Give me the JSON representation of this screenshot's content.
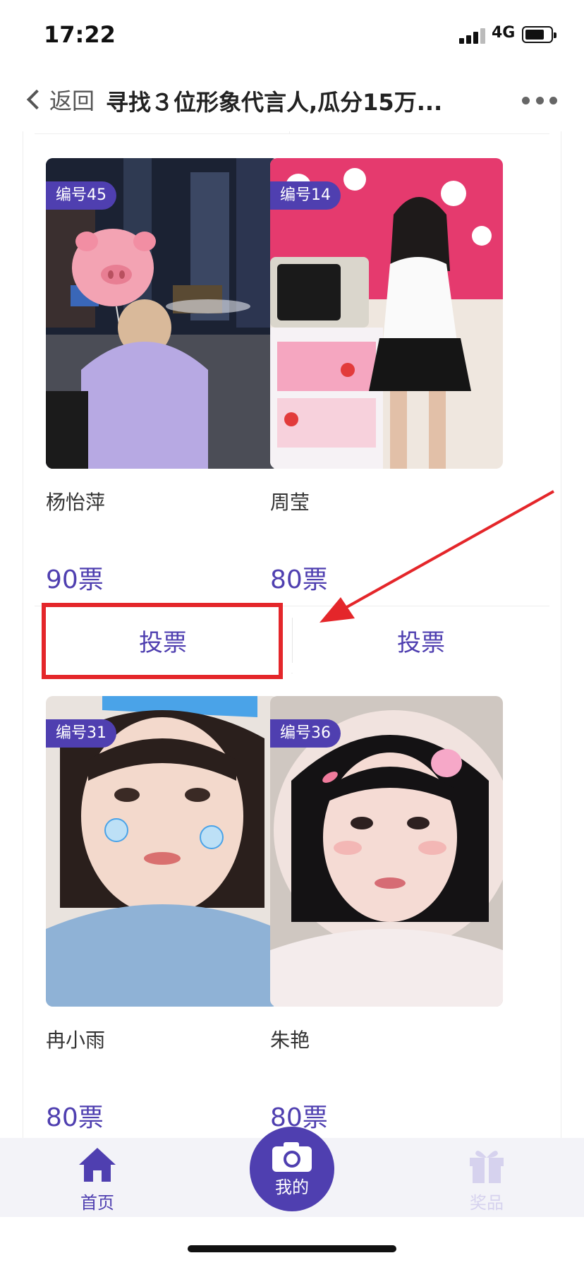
{
  "status_bar": {
    "time": "17:22",
    "network": "4G"
  },
  "nav": {
    "back_label": "返回",
    "title": "寻找３位形象代言人,瓜分15万..."
  },
  "contestants": [
    {
      "id_label": "编号45",
      "name": "杨怡萍",
      "votes": "90票",
      "vote_button": "投票"
    },
    {
      "id_label": "编号14",
      "name": "周莹",
      "votes": "80票",
      "vote_button": "投票"
    },
    {
      "id_label": "编号31",
      "name": "冉小雨",
      "votes": "80票"
    },
    {
      "id_label": "编号36",
      "name": "朱艳",
      "votes": "80票"
    }
  ],
  "tab_bar": {
    "home_label": "首页",
    "mine_label": "我的",
    "prize_label": "奖品"
  },
  "colors": {
    "accent": "#4f3fb0",
    "highlight": "#e4262a",
    "tab_inactive": "#d6d2ee"
  }
}
